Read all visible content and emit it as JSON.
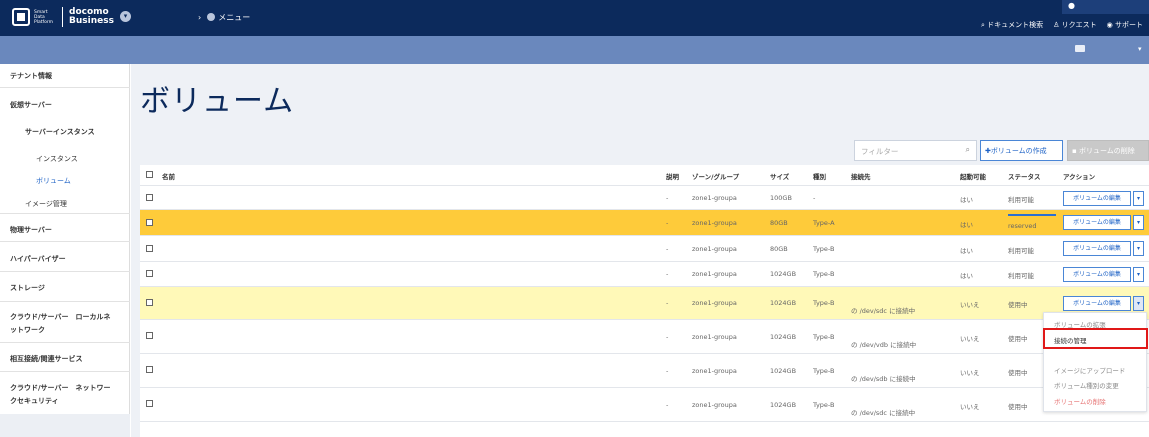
{
  "header": {
    "logo_sdp": "Smart Data Platform",
    "logo_brand_1": "docomo",
    "logo_brand_2": "Business",
    "menu": "メニュー",
    "links": [
      "ドキュメント検索",
      "リクエスト",
      "サポート"
    ]
  },
  "sidebar": {
    "items": [
      {
        "label": "テナント情報"
      },
      {
        "label": "仮想サーバー"
      },
      {
        "label": "サーバーインスタンス"
      },
      {
        "label": "インスタンス"
      },
      {
        "label": "ボリューム"
      },
      {
        "label": "イメージ管理"
      },
      {
        "label": "物理サーバー"
      },
      {
        "label": "ハイパーバイザー"
      },
      {
        "label": "ストレージ"
      },
      {
        "label": "クラウド/サーバー　ローカルネ"
      },
      {
        "label": "ットワーク"
      },
      {
        "label": "相互接続/関連サービス"
      },
      {
        "label": "クラウド/サーバー　ネットワー"
      },
      {
        "label": "クセキュリティ"
      }
    ]
  },
  "main": {
    "title": "ボリューム",
    "filter_placeholder": "フィルター",
    "create_button": "ボリュームの作成",
    "delete_button": "ボリュームの削除"
  },
  "table": {
    "headers": {
      "name": "名前",
      "desc": "説明",
      "zone": "ゾーン/グループ",
      "size": "サイズ",
      "type": "種別",
      "conn": "接続先",
      "boot": "起動可能",
      "status": "ステータス",
      "action": "アクション"
    },
    "rows": [
      {
        "desc": "-",
        "zone": "zone1-groupa",
        "size": "100GB",
        "type": "-",
        "conn": "",
        "boot": "はい",
        "status": "利用可能",
        "action": "ボリュームの編集"
      },
      {
        "desc": "-",
        "zone": "zone1-groupa",
        "size": "80GB",
        "type": "Type-A",
        "conn": "",
        "boot": "はい",
        "status": "reserved",
        "action": "ボリュームの編集"
      },
      {
        "desc": "-",
        "zone": "zone1-groupa",
        "size": "80GB",
        "type": "Type-B",
        "conn": "",
        "boot": "はい",
        "status": "利用可能",
        "action": "ボリュームの編集"
      },
      {
        "desc": "-",
        "zone": "zone1-groupa",
        "size": "1024GB",
        "type": "Type-B",
        "conn": "",
        "boot": "はい",
        "status": "利用可能",
        "action": "ボリュームの編集"
      },
      {
        "desc": "-",
        "zone": "zone1-groupa",
        "size": "1024GB",
        "type": "Type-B",
        "conn": "の /dev/sdc に接続中",
        "boot": "いいえ",
        "status": "使用中",
        "action": "ボリュームの編集"
      },
      {
        "desc": "-",
        "zone": "zone1-groupa",
        "size": "1024GB",
        "type": "Type-B",
        "conn": "の /dev/vdb に接続中",
        "boot": "いいえ",
        "status": "使用中",
        "action": ""
      },
      {
        "desc": "-",
        "zone": "zone1-groupa",
        "size": "1024GB",
        "type": "Type-B",
        "conn": "の /dev/sdb に接続中",
        "boot": "いいえ",
        "status": "使用中",
        "action": ""
      },
      {
        "desc": "-",
        "zone": "zone1-groupa",
        "size": "1024GB",
        "type": "Type-B",
        "conn": "の /dev/sdc に接続中",
        "boot": "いいえ",
        "status": "使用中",
        "action": ""
      }
    ]
  },
  "dropdown": {
    "items": [
      "ボリュームの拡張",
      "接続の管理",
      "",
      "イメージにアップロード",
      "ボリューム種別の変更",
      "ボリュームの削除"
    ]
  },
  "colors": {
    "topbar": "#0c2a5c",
    "subbar": "#6a88bd",
    "highlight_selected": "#fecb3a",
    "highlight_row": "#fff9b8",
    "accent": "#1f63c6",
    "focus_box": "#e01818"
  }
}
